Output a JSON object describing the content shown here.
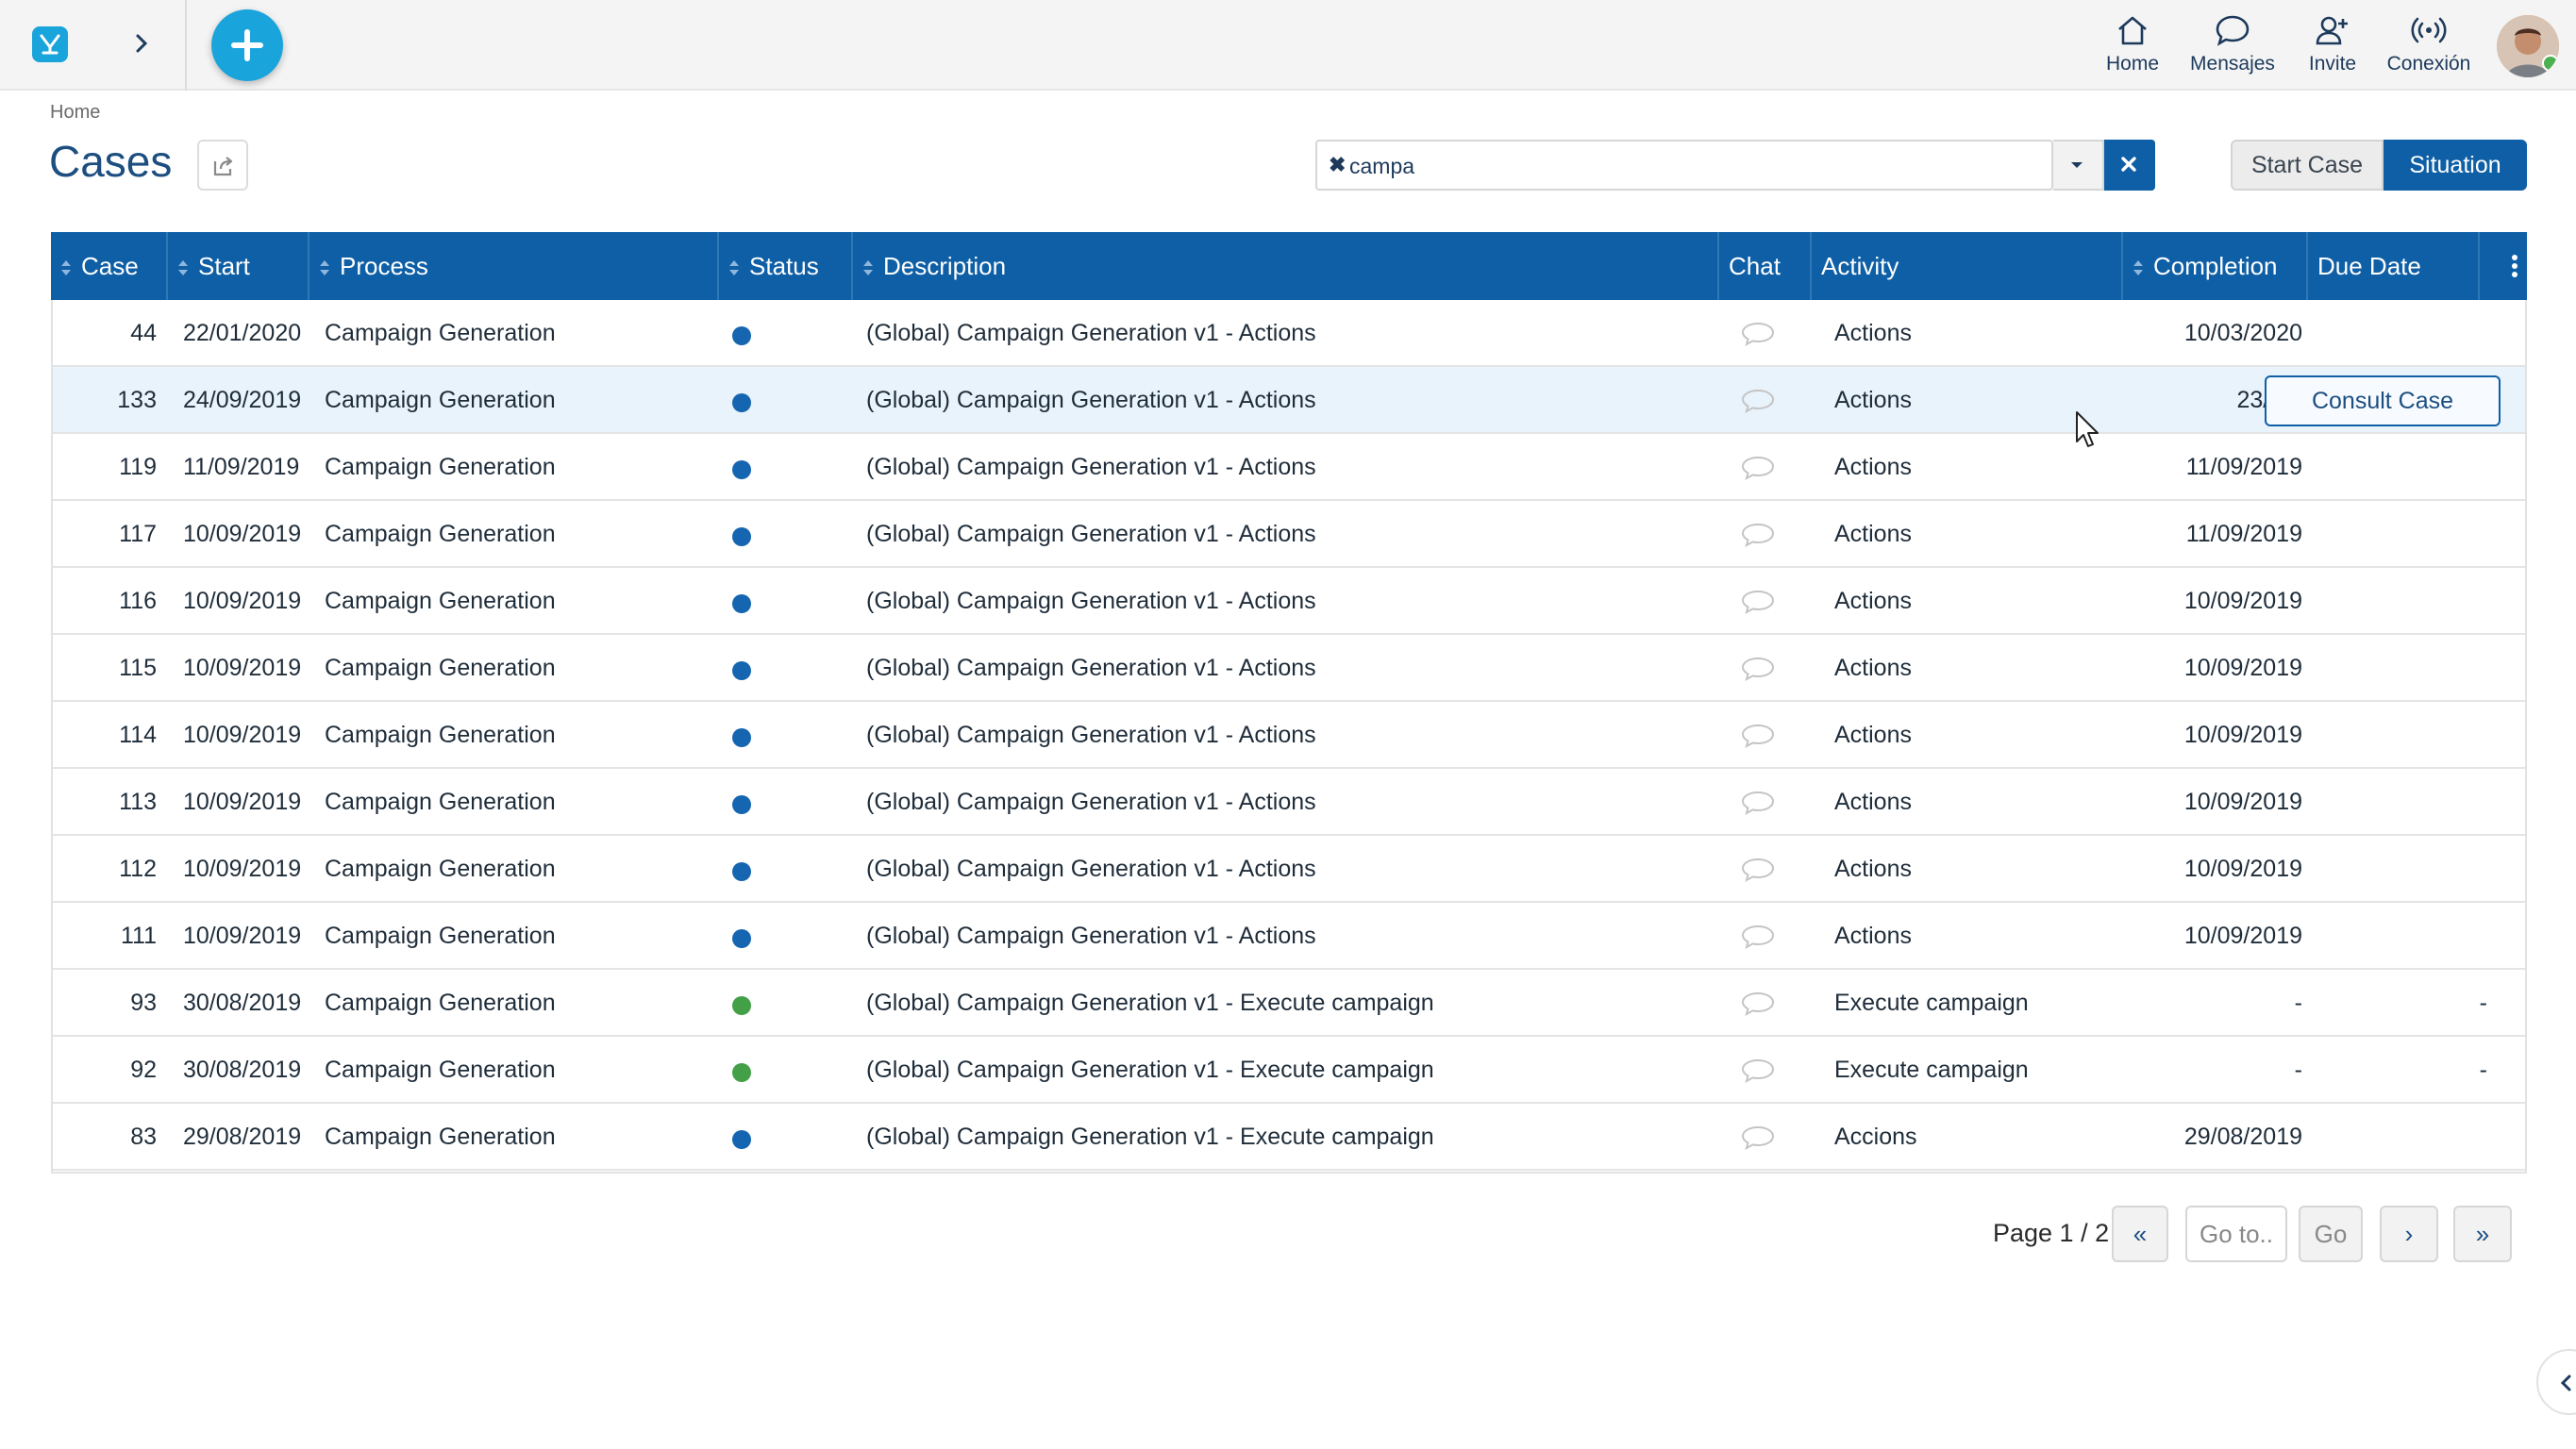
{
  "topbar": {
    "nav": [
      {
        "label": "Home",
        "icon": "home-icon"
      },
      {
        "label": "Mensajes",
        "icon": "chat-bubble-icon"
      },
      {
        "label": "Invite",
        "icon": "user-plus-icon"
      },
      {
        "label": "Conexión",
        "icon": "broadcast-icon"
      }
    ]
  },
  "page": {
    "breadcrumb": "Home",
    "title": "Cases"
  },
  "search": {
    "chip_remove": "✖",
    "value": "campa"
  },
  "actions": {
    "start_case": "Start Case",
    "situation": "Situation"
  },
  "table": {
    "columns": [
      "Case",
      "Start",
      "Process",
      "Status",
      "Description",
      "Chat",
      "Activity",
      "Completion",
      "Due Date"
    ],
    "rows": [
      {
        "case": "44",
        "start": "22/01/2020",
        "process": "Campaign Generation",
        "status": "blue",
        "description": "(Global) Campaign Generation v1 - Actions",
        "activity": "Actions",
        "completion": "10/03/2020",
        "due": ""
      },
      {
        "case": "133",
        "start": "24/09/2019",
        "process": "Campaign Generation",
        "status": "blue",
        "description": "(Global) Campaign Generation v1 - Actions",
        "activity": "Actions",
        "completion": "23/10/",
        "due": ""
      },
      {
        "case": "119",
        "start": "11/09/2019",
        "process": "Campaign Generation",
        "status": "blue",
        "description": "(Global) Campaign Generation v1 - Actions",
        "activity": "Actions",
        "completion": "11/09/2019",
        "due": ""
      },
      {
        "case": "117",
        "start": "10/09/2019",
        "process": "Campaign Generation",
        "status": "blue",
        "description": "(Global) Campaign Generation v1 - Actions",
        "activity": "Actions",
        "completion": "11/09/2019",
        "due": ""
      },
      {
        "case": "116",
        "start": "10/09/2019",
        "process": "Campaign Generation",
        "status": "blue",
        "description": "(Global) Campaign Generation v1 - Actions",
        "activity": "Actions",
        "completion": "10/09/2019",
        "due": ""
      },
      {
        "case": "115",
        "start": "10/09/2019",
        "process": "Campaign Generation",
        "status": "blue",
        "description": "(Global) Campaign Generation v1 - Actions",
        "activity": "Actions",
        "completion": "10/09/2019",
        "due": ""
      },
      {
        "case": "114",
        "start": "10/09/2019",
        "process": "Campaign Generation",
        "status": "blue",
        "description": "(Global) Campaign Generation v1 - Actions",
        "activity": "Actions",
        "completion": "10/09/2019",
        "due": ""
      },
      {
        "case": "113",
        "start": "10/09/2019",
        "process": "Campaign Generation",
        "status": "blue",
        "description": "(Global) Campaign Generation v1 - Actions",
        "activity": "Actions",
        "completion": "10/09/2019",
        "due": ""
      },
      {
        "case": "112",
        "start": "10/09/2019",
        "process": "Campaign Generation",
        "status": "blue",
        "description": "(Global) Campaign Generation v1 - Actions",
        "activity": "Actions",
        "completion": "10/09/2019",
        "due": ""
      },
      {
        "case": "111",
        "start": "10/09/2019",
        "process": "Campaign Generation",
        "status": "blue",
        "description": "(Global) Campaign Generation v1 - Actions",
        "activity": "Actions",
        "completion": "10/09/2019",
        "due": ""
      },
      {
        "case": "93",
        "start": "30/08/2019",
        "process": "Campaign Generation",
        "status": "green",
        "description": "(Global) Campaign Generation v1 - Execute campaign",
        "activity": "Execute campaign",
        "completion": "-",
        "due": "-"
      },
      {
        "case": "92",
        "start": "30/08/2019",
        "process": "Campaign Generation",
        "status": "green",
        "description": "(Global) Campaign Generation v1 - Execute campaign",
        "activity": "Execute campaign",
        "completion": "-",
        "due": "-"
      },
      {
        "case": "83",
        "start": "29/08/2019",
        "process": "Campaign Generation",
        "status": "blue",
        "description": "(Global) Campaign Generation v1 - Execute campaign",
        "activity": "Accions",
        "completion": "29/08/2019",
        "due": ""
      }
    ],
    "hover_action": "Consult Case"
  },
  "status_colors": {
    "blue": "#1565b0",
    "green": "#43a047"
  },
  "pagination": {
    "info": "Page 1 / 2",
    "first": "«",
    "goto_placeholder": "Go to..",
    "go": "Go",
    "next": "›",
    "last": "»"
  }
}
